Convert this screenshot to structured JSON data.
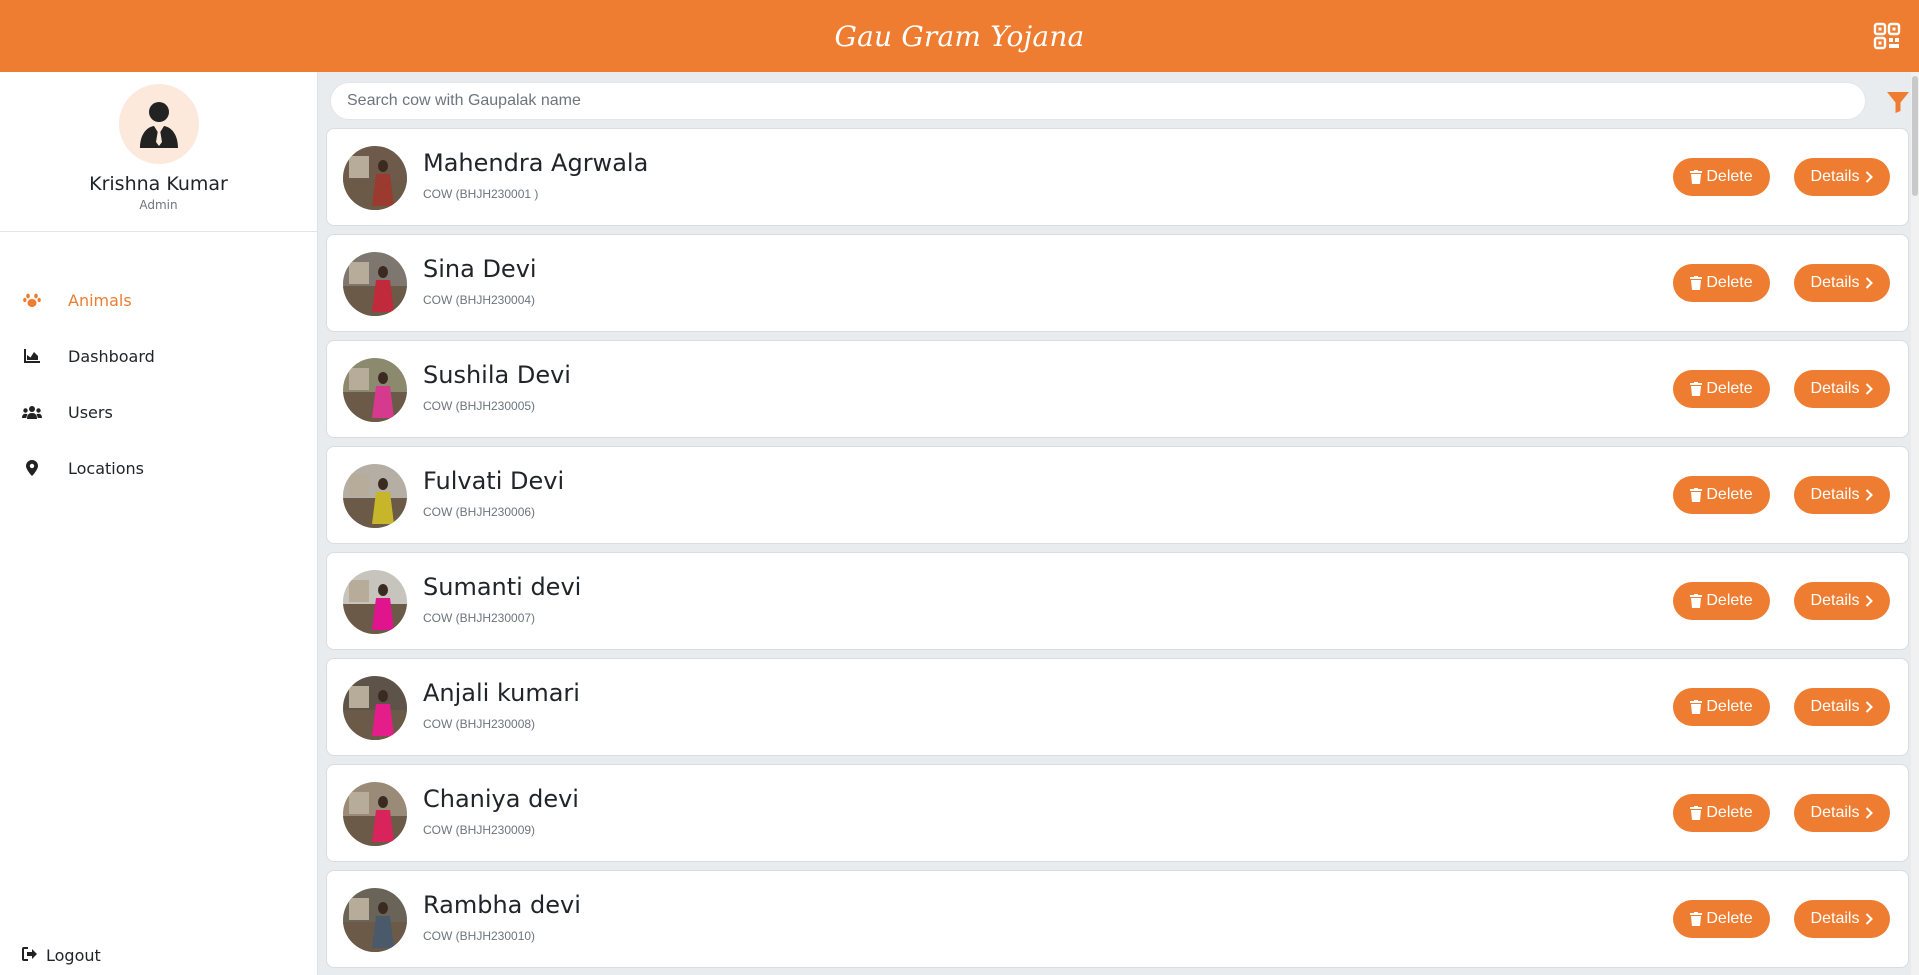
{
  "app": {
    "title": "Gau Gram Yojana"
  },
  "colors": {
    "accent": "#ee7d31",
    "background": "#e9ecef"
  },
  "profile": {
    "name": "Krishna Kumar",
    "role": "Admin"
  },
  "nav": {
    "items": [
      {
        "label": "Animals",
        "icon": "paw-icon",
        "active": true
      },
      {
        "label": "Dashboard",
        "icon": "chart-icon",
        "active": false
      },
      {
        "label": "Users",
        "icon": "users-icon",
        "active": false
      },
      {
        "label": "Locations",
        "icon": "location-pin-icon",
        "active": false
      }
    ],
    "logout_label": "Logout"
  },
  "search": {
    "placeholder": "Search cow with Gaupalak name",
    "value": ""
  },
  "buttons": {
    "delete_label": "Delete",
    "details_label": "Details"
  },
  "animals": [
    {
      "owner": "Mahendra Agrwala",
      "code": "COW (BHJH230001 )"
    },
    {
      "owner": "Sina Devi",
      "code": "COW (BHJH230004)"
    },
    {
      "owner": "Sushila Devi",
      "code": "COW (BHJH230005)"
    },
    {
      "owner": "Fulvati Devi",
      "code": "COW (BHJH230006)"
    },
    {
      "owner": "Sumanti devi",
      "code": "COW (BHJH230007)"
    },
    {
      "owner": "Anjali kumari",
      "code": "COW (BHJH230008)"
    },
    {
      "owner": "Chaniya devi",
      "code": "COW (BHJH230009)"
    },
    {
      "owner": "Rambha devi",
      "code": "COW (BHJH230010)"
    }
  ]
}
